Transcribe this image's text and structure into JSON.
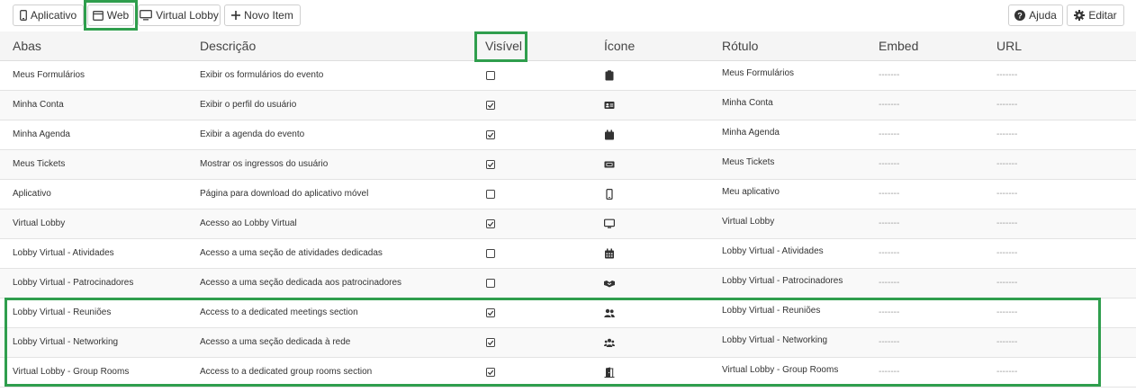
{
  "toolbar": {
    "aplicativo": "Aplicativo",
    "web": "Web",
    "virtual_lobby": "Virtual Lobby",
    "novo_item": "Novo Item",
    "ajuda": "Ajuda",
    "editar": "Editar"
  },
  "table": {
    "headers": {
      "abas": "Abas",
      "descricao": "Descrição",
      "visivel": "Visível",
      "icone": "Ícone",
      "rotulo": "Rótulo",
      "embed": "Embed",
      "url": "URL"
    },
    "rows": [
      {
        "aba": "Meus Formulários",
        "descricao": "Exibir os formulários do evento",
        "visivel": false,
        "icone": "clipboard-icon",
        "rotulo": "Meus Formulários",
        "embed": "-------",
        "url": "-------"
      },
      {
        "aba": "Minha Conta",
        "descricao": "Exibir o perfil do usuário",
        "visivel": true,
        "icone": "id-card-icon",
        "rotulo": "Minha Conta",
        "embed": "-------",
        "url": "-------"
      },
      {
        "aba": "Minha Agenda",
        "descricao": "Exibir a agenda do evento",
        "visivel": true,
        "icone": "calendar-icon",
        "rotulo": "Minha Agenda",
        "embed": "-------",
        "url": "-------"
      },
      {
        "aba": "Meus Tickets",
        "descricao": "Mostrar os ingressos do usuário",
        "visivel": true,
        "icone": "ticket-icon",
        "rotulo": "Meus Tickets",
        "embed": "-------",
        "url": "-------"
      },
      {
        "aba": "Aplicativo",
        "descricao": "Página para download do aplicativo móvel",
        "visivel": false,
        "icone": "mobile-icon",
        "rotulo": "Meu aplicativo",
        "embed": "-------",
        "url": "-------"
      },
      {
        "aba": "Virtual Lobby",
        "descricao": "Acesso ao Lobby Virtual",
        "visivel": true,
        "icone": "desktop-icon",
        "rotulo": "Virtual Lobby",
        "embed": "-------",
        "url": "-------"
      },
      {
        "aba": "Lobby Virtual - Atividades",
        "descricao": "Acesso a uma seção de atividades dedicadas",
        "visivel": false,
        "icone": "calendar-grid-icon",
        "rotulo": "Lobby Virtual - Atividades",
        "embed": "-------",
        "url": "-------"
      },
      {
        "aba": "Lobby Virtual - Patrocinadores",
        "descricao": "Acesso a uma seção dedicada aos patrocinadores",
        "visivel": false,
        "icone": "handshake-icon",
        "rotulo": "Lobby Virtual - Patrocinadores",
        "embed": "-------",
        "url": "-------"
      },
      {
        "aba": "Lobby Virtual - Reuniões",
        "descricao": "Access to a dedicated meetings section",
        "visivel": true,
        "icone": "user-friends-icon",
        "rotulo": "Lobby Virtual - Reuniões",
        "embed": "-------",
        "url": "-------"
      },
      {
        "aba": "Lobby Virtual - Networking",
        "descricao": "Acesso a uma seção dedicada à rede",
        "visivel": true,
        "icone": "users-icon",
        "rotulo": "Lobby Virtual - Networking",
        "embed": "-------",
        "url": "-------"
      },
      {
        "aba": "Virtual Lobby - Group Rooms",
        "descricao": "Access to a dedicated group rooms section",
        "visivel": true,
        "icone": "door-open-icon",
        "rotulo": "Virtual Lobby - Group Rooms",
        "embed": "-------",
        "url": "-------"
      }
    ]
  },
  "colors": {
    "highlight": "#2f9e4d",
    "header_bg": "#f5f5f5",
    "row_alt_bg": "#f9f9f9",
    "border": "#dddddd"
  }
}
